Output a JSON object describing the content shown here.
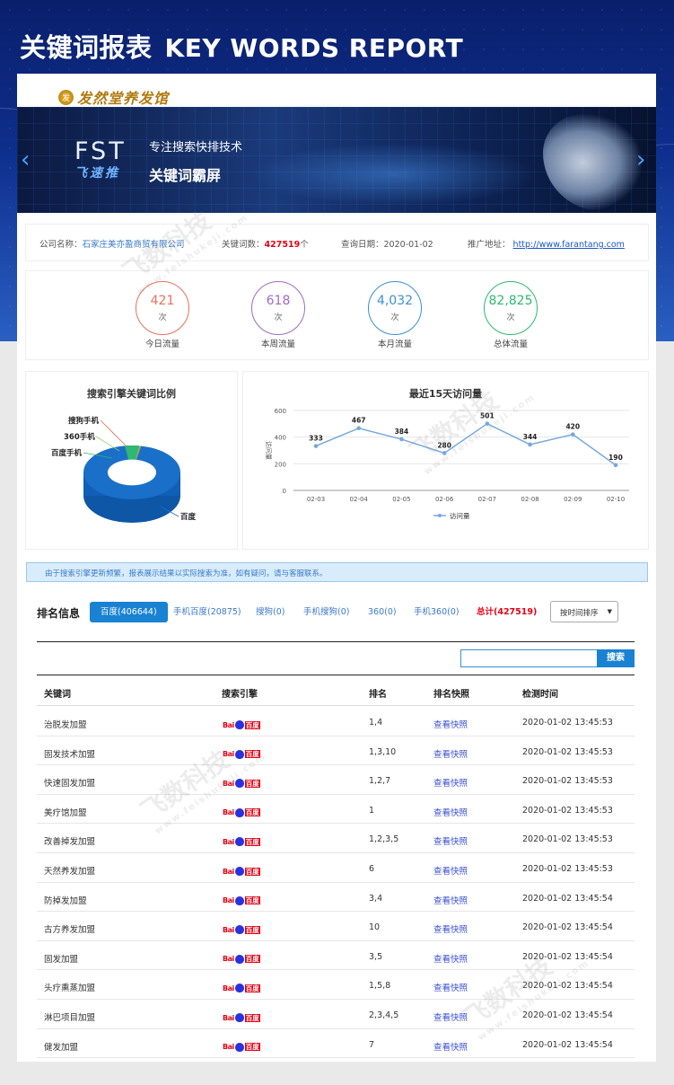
{
  "page_title": {
    "cn": "关键词报表",
    "en": "KEY WORDS REPORT"
  },
  "logo": {
    "seal": "发",
    "text": "发然堂养发馆"
  },
  "banner": {
    "brand_big": "FST",
    "brand_small": "飞速推",
    "slogan_line1": "专注搜索快排技术",
    "slogan_line2": "关键词霸屏",
    "prev": "‹",
    "next": "›"
  },
  "info": {
    "company_label": "公司名称：",
    "company": "石家庄美亦盈商贸有限公司",
    "keywords_label": "关键词数：",
    "keywords_count": "427519",
    "keywords_unit": "个",
    "date_label": "查询日期：",
    "date": "2020-01-02",
    "url_label": "推广地址：",
    "url": "http://www.farantang.com"
  },
  "traffic": [
    {
      "value": "421",
      "unit": "次",
      "label": "今日流量",
      "color": "#e8705e"
    },
    {
      "value": "618",
      "unit": "次",
      "label": "本周流量",
      "color": "#a06bc4"
    },
    {
      "value": "4,032",
      "unit": "次",
      "label": "本月流量",
      "color": "#3a8fd6"
    },
    {
      "value": "82,825",
      "unit": "次",
      "label": "总体流量",
      "color": "#2eb872"
    }
  ],
  "chart_data": [
    {
      "type": "pie",
      "title": "搜索引擎关键词比例",
      "labels": [
        "百度",
        "百度手机",
        "360手机",
        "搜狗手机"
      ],
      "values": [
        406644,
        20875,
        0,
        0
      ],
      "colors": [
        "#1a6fc9",
        "#2eb872",
        "#8ed16b",
        "#e06b5a"
      ]
    },
    {
      "type": "line",
      "title": "最近15天访问量",
      "x": [
        "02-03",
        "02-04",
        "02-05",
        "02-06",
        "02-07",
        "02-08",
        "02-09",
        "02-10"
      ],
      "series": [
        {
          "name": "访问量",
          "values": [
            333,
            467,
            384,
            280,
            501,
            344,
            420,
            190
          ],
          "color": "#76a8dd"
        }
      ],
      "ylabel": "访问量",
      "ylim": [
        0,
        600
      ],
      "yticks": [
        0,
        200,
        400,
        600
      ],
      "grid": true,
      "legend": "bottom"
    }
  ],
  "notice": "由于搜索引擎更新频繁，报表展示结果以实际搜索为准，如有疑问，请与客服联系。",
  "ranking": {
    "heading": "排名信息",
    "tabs": [
      {
        "label": "百度(406644)"
      },
      {
        "label": "手机百度(20875)"
      },
      {
        "label": "搜狗(0)"
      },
      {
        "label": "手机搜狗(0)"
      },
      {
        "label": "360(0)"
      },
      {
        "label": "手机360(0)"
      },
      {
        "label": "总计(427519)"
      }
    ],
    "sort_label": "按时间排序",
    "search_button": "搜索",
    "search_value": "",
    "columns": [
      "关键词",
      "搜索引擎",
      "排名",
      "排名快照",
      "检测时间"
    ],
    "engine_logo": {
      "bai": "Bai",
      "du": "百度"
    },
    "rows": [
      {
        "keyword": "治脱发加盟",
        "rank": "1,4",
        "snapshot": "查看快照",
        "time": "2020-01-02 13:45:53"
      },
      {
        "keyword": "固发技术加盟",
        "rank": "1,3,10",
        "snapshot": "查看快照",
        "time": "2020-01-02 13:45:53"
      },
      {
        "keyword": "快速固发加盟",
        "rank": "1,2,7",
        "snapshot": "查看快照",
        "time": "2020-01-02 13:45:53"
      },
      {
        "keyword": "美疗馆加盟",
        "rank": "1",
        "snapshot": "查看快照",
        "time": "2020-01-02 13:45:53"
      },
      {
        "keyword": "改善掉发加盟",
        "rank": "1,2,3,5",
        "snapshot": "查看快照",
        "time": "2020-01-02 13:45:53"
      },
      {
        "keyword": "天然养发加盟",
        "rank": "6",
        "snapshot": "查看快照",
        "time": "2020-01-02 13:45:53"
      },
      {
        "keyword": "防掉发加盟",
        "rank": "3,4",
        "snapshot": "查看快照",
        "time": "2020-01-02 13:45:54"
      },
      {
        "keyword": "古方养发加盟",
        "rank": "10",
        "snapshot": "查看快照",
        "time": "2020-01-02 13:45:54"
      },
      {
        "keyword": "固发加盟",
        "rank": "3,5",
        "snapshot": "查看快照",
        "time": "2020-01-02 13:45:54"
      },
      {
        "keyword": "头疗熏蒸加盟",
        "rank": "1,5,8",
        "snapshot": "查看快照",
        "time": "2020-01-02 13:45:54"
      },
      {
        "keyword": "淋巴项目加盟",
        "rank": "2,3,4,5",
        "snapshot": "查看快照",
        "time": "2020-01-02 13:45:54"
      },
      {
        "keyword": "健发加盟",
        "rank": "7",
        "snapshot": "查看快照",
        "time": "2020-01-02 13:45:54"
      }
    ]
  },
  "watermark": {
    "cn": "飞数科技",
    "en": "www.feishukeji.com"
  }
}
